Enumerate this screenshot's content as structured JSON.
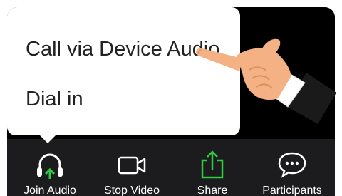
{
  "popup_menu": {
    "items": [
      {
        "label": "Call via Device Audio"
      },
      {
        "label": "Dial in"
      }
    ]
  },
  "toolbar": {
    "buttons": [
      {
        "label": "Join Audio",
        "icon": "headphones-icon"
      },
      {
        "label": "Stop Video",
        "icon": "video-camera-icon"
      },
      {
        "label": "Share",
        "icon": "share-upload-icon"
      },
      {
        "label": "Participants",
        "icon": "chat-bubble-icon"
      }
    ]
  },
  "colors": {
    "background": "#000000",
    "toolbar": "#1c1c1e",
    "popup": "#ffffff",
    "accent_green": "#2ecc40",
    "text_light": "#ffffff",
    "text_dark": "#222222"
  }
}
